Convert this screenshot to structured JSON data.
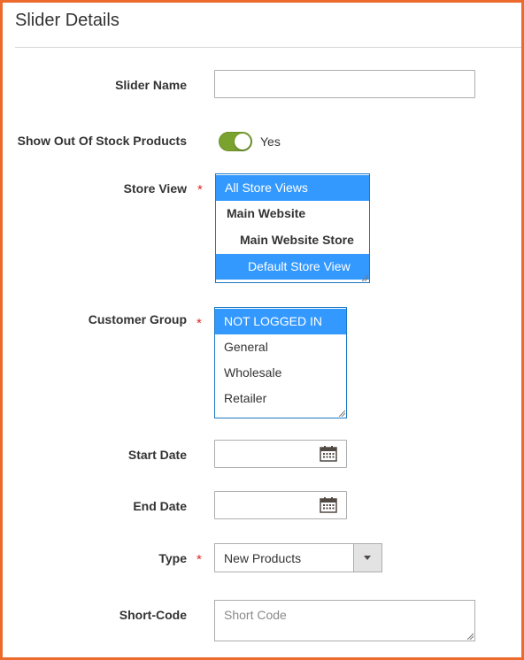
{
  "section": {
    "title": "Slider Details"
  },
  "fields": {
    "slider_name": {
      "label": "Slider Name",
      "value": ""
    },
    "show_out_of_stock": {
      "label": "Show Out Of Stock Products",
      "state": "Yes",
      "enabled": true
    },
    "store_view": {
      "label": "Store View",
      "required": "*",
      "options": [
        {
          "label": "All Store Views",
          "selected": true
        },
        {
          "label": "Main Website",
          "selected": false
        },
        {
          "label": "Main Website Store",
          "selected": false
        },
        {
          "label": "Default Store View",
          "selected": true
        }
      ]
    },
    "customer_group": {
      "label": "Customer Group",
      "required": "*",
      "options": [
        {
          "label": "NOT LOGGED IN",
          "selected": true
        },
        {
          "label": "General",
          "selected": false
        },
        {
          "label": "Wholesale",
          "selected": false
        },
        {
          "label": "Retailer",
          "selected": false
        }
      ]
    },
    "start_date": {
      "label": "Start Date",
      "value": ""
    },
    "end_date": {
      "label": "End Date",
      "value": ""
    },
    "type": {
      "label": "Type",
      "required": "*",
      "value": "New Products"
    },
    "short_code": {
      "label": "Short-Code",
      "placeholder": "Short Code"
    }
  },
  "colors": {
    "frame_border": "#eb6a2c",
    "toggle_on": "#79a22e",
    "selected_option": "#3399ff",
    "required_star": "#e22626"
  }
}
